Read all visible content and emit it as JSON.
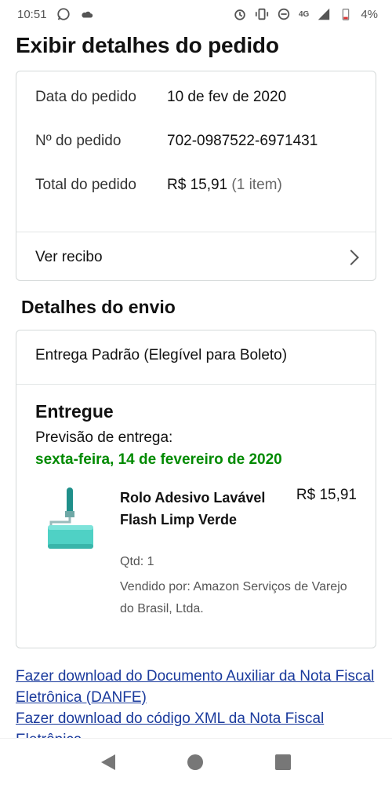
{
  "status_bar": {
    "time": "10:51",
    "network": "4G",
    "battery": "4%",
    "icons": [
      "whatsapp-icon",
      "cloud-icon",
      "alarm-icon",
      "vibrate-icon",
      "dnd-icon",
      "signal-icon",
      "battery-icon"
    ]
  },
  "page": {
    "title": "Exibir detalhes do pedido"
  },
  "order": {
    "date_label": "Data do pedido",
    "date_value": "10 de fev de 2020",
    "number_label": "Nº do pedido",
    "number_value": "702-0987522-6971431",
    "total_label": "Total do pedido",
    "total_value": "R$ 15,91",
    "total_items": "(1 item)",
    "receipt_link": "Ver recibo"
  },
  "shipping": {
    "section_title": "Detalhes do envio",
    "method": "Entrega Padrão (Elegível para Boleto)",
    "status": "Entregue",
    "forecast_label": "Previsão de entrega:",
    "forecast_date": "sexta-feira, 14 de fevereiro de 2020",
    "item": {
      "name": "Rolo Adesivo Lavável Flash Limp Verde",
      "price": "R$ 15,91",
      "qty": "Qtd: 1",
      "seller": "Vendido por: Amazon Serviços de Varejo do Brasil, Ltda."
    }
  },
  "links": {
    "danfe": "Fazer download do Documento Auxiliar da Nota Fiscal Eletrônica (DANFE)",
    "xml": "Fazer download do código XML da Nota Fiscal Eletrônica"
  },
  "colors": {
    "accent_green": "#008a00",
    "link_blue": "#1a3a9c",
    "border": "#d5d9d9",
    "product_teal": "#4fd1c5"
  }
}
